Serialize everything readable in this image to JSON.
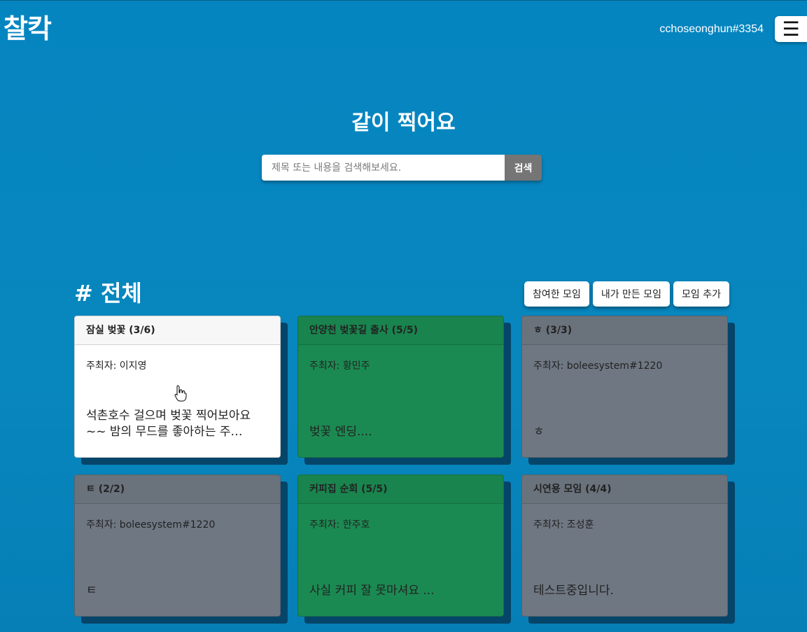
{
  "header": {
    "logo": "찰칵",
    "username": "cchoseonghun#3354",
    "menu_icon": "hamburger-icon"
  },
  "hero": {
    "title": "같이 찍어요"
  },
  "search": {
    "placeholder": "제목 또는 내용을 검색해보세요.",
    "value": "",
    "button_label": "검색"
  },
  "section": {
    "title": "# 전체",
    "actions": [
      "참여한 모임",
      "내가 만든 모임",
      "모임 추가"
    ]
  },
  "cards": [
    {
      "title": "잠실 벚꽃 (3/6)",
      "host": "주최자: 이지영",
      "desc": "석촌호수 걸으며 벚꽃 찍어보아요~~ 밤의 무드를 좋아하는 주…",
      "color": "#ffffff"
    },
    {
      "title": "안양천 벚꽃길 출사 (5/5)",
      "host": "주최자: 황민주",
      "desc": "벚꽃 엔딩....",
      "color": "#1b8a52"
    },
    {
      "title": "ㅎ (3/3)",
      "host": "주최자: boleesystem#1220",
      "desc": "ㅎ",
      "color": "#6f7782"
    },
    {
      "title": "ㅌ (2/2)",
      "host": "주최자: boleesystem#1220",
      "desc": "ㅌ",
      "color": "#6f7782"
    },
    {
      "title": "커피집 순회 (5/5)",
      "host": "주최자: 한주호",
      "desc": "사실 커피 잘 못마셔요 ...",
      "color": "#1b8a52"
    },
    {
      "title": "시연용 모임 (4/4)",
      "host": "주최자: 조성훈",
      "desc": "테스트중입니다.",
      "color": "#6f7782"
    }
  ]
}
